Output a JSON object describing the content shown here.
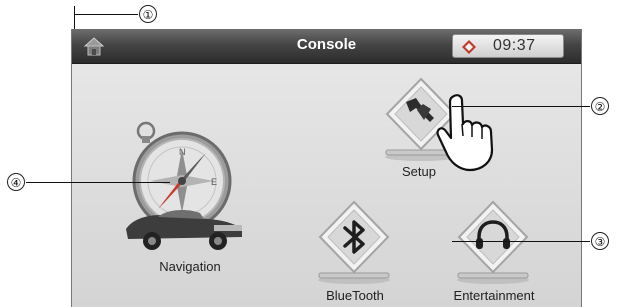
{
  "callouts": [
    "①",
    "②",
    "③",
    "④"
  ],
  "titlebar": {
    "title": "Console",
    "time": "09:37"
  },
  "tiles": {
    "setup": "Setup",
    "navigation": "Navigation",
    "bluetooth": "BlueTooth",
    "entertainment": "Entertainment"
  },
  "icons": {
    "home": "home-icon",
    "gps": "gps-icon",
    "setup": "wrench-icon",
    "navigation": "compass-car-icon",
    "bluetooth": "bluetooth-icon",
    "entertainment": "headphones-icon",
    "pointer": "hand-pointer-icon"
  }
}
